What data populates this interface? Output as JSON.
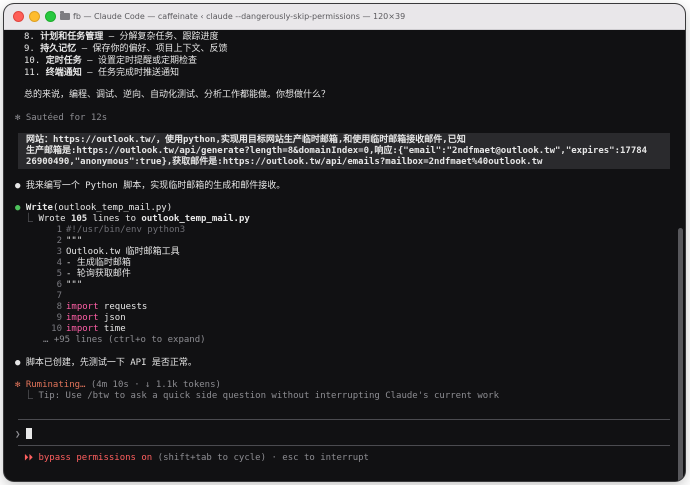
{
  "window": {
    "title_folder": "fb",
    "title_text": "— Claude Code — caffeinate ‹ claude --dangerously-skip-permissions — 120×39"
  },
  "features": [
    {
      "num": "8.",
      "name": "计划和任务管理",
      "desc": " — 分解复杂任务、跟踪进度"
    },
    {
      "num": "9.",
      "name": "持久记忆",
      "desc": " — 保存你的偏好、项目上下文、反馈"
    },
    {
      "num": "10.",
      "name": "定时任务",
      "desc": " — 设置定时提醒或定期检查"
    },
    {
      "num": "11.",
      "name": "终端通知",
      "desc": " — 任务完成时推送通知"
    }
  ],
  "summary": "总的来说，编程、调试、逆向、自动化测试、分析工作都能做。你想做什么？",
  "sauteed": {
    "icon": "✻",
    "text": "Sautéed for 12s"
  },
  "user_prompt": [
    "网站：https://outlook.tw/，使用python,实现用目标网站生产临时邮箱,和使用临时邮箱接收邮件,已知",
    "生产邮箱是:https://outlook.tw/api/generate?length=8&domainIndex=0,响应:{\"email\":\"2ndfmaet@outlook.tw\",\"expires\":17784",
    "26900490,\"anonymous\":true},获取邮件是:https://outlook.tw/api/emails?mailbox=2ndfmaet%40outlook.tw"
  ],
  "assistant_msg_1": "我来编写一个 Python 脚本，实现临时邮箱的生成和邮件接收。",
  "tool": {
    "name": "Write",
    "arg": "(outlook_temp_mail.py)",
    "result_prefix": "Wrote ",
    "result_count": "105",
    "result_mid": " lines to ",
    "result_file": "outlook_temp_mail.py",
    "code": [
      {
        "n": "1",
        "kw": "",
        "text": "#!/usr/bin/env python3",
        "style": "comment"
      },
      {
        "n": "2",
        "kw": "",
        "text": "\"\"\"",
        "style": ""
      },
      {
        "n": "3",
        "kw": "",
        "text": "Outlook.tw 临时邮箱工具",
        "style": ""
      },
      {
        "n": "4",
        "kw": "",
        "text": "- 生成临时邮箱",
        "style": ""
      },
      {
        "n": "5",
        "kw": "",
        "text": "- 轮询获取邮件",
        "style": ""
      },
      {
        "n": "6",
        "kw": "",
        "text": "\"\"\"",
        "style": ""
      },
      {
        "n": "7",
        "kw": "",
        "text": "",
        "style": ""
      },
      {
        "n": "8",
        "kw": "import",
        "text": " requests",
        "style": ""
      },
      {
        "n": "9",
        "kw": "import",
        "text": " json",
        "style": ""
      },
      {
        "n": "10",
        "kw": "import",
        "text": " time",
        "style": ""
      }
    ],
    "more": "… +95 lines (ctrl+o to expand)"
  },
  "assistant_msg_2": "脚本已创建，先测试一下 API 是否正常。",
  "status": {
    "icon": "✻",
    "label": "Ruminating…",
    "detail": " (4m 10s · ↓ 1.1k tokens)",
    "tip": "Tip: Use /btw to ask a quick side question without interrupting Claude's current work"
  },
  "prompt_symbol": "❯",
  "footer": {
    "arrows": "⏵⏵",
    "mode": "bypass permissions on",
    "hint": " (shift+tab to cycle) · esc to interrupt"
  },
  "colors": {
    "accent": "#e2745a",
    "success": "#4ec25c",
    "keyword": "#ff5fa6",
    "danger": "#ff5f5f"
  }
}
